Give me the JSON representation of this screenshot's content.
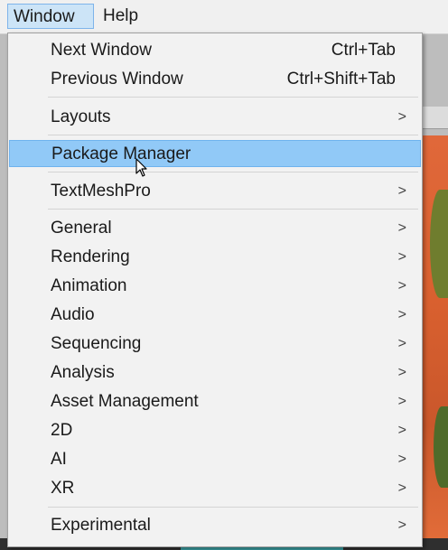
{
  "menubar": {
    "window_label": "Window",
    "help_label": "Help"
  },
  "menu": {
    "next_window": {
      "label": "Next Window",
      "shortcut": "Ctrl+Tab"
    },
    "previous_window": {
      "label": "Previous Window",
      "shortcut": "Ctrl+Shift+Tab"
    },
    "layouts": {
      "label": "Layouts"
    },
    "package_manager": {
      "label": "Package Manager"
    },
    "textmeshpro": {
      "label": "TextMeshPro"
    },
    "general": {
      "label": "General"
    },
    "rendering": {
      "label": "Rendering"
    },
    "animation": {
      "label": "Animation"
    },
    "audio": {
      "label": "Audio"
    },
    "sequencing": {
      "label": "Sequencing"
    },
    "analysis": {
      "label": "Analysis"
    },
    "asset_management": {
      "label": "Asset Management"
    },
    "two_d": {
      "label": "2D"
    },
    "ai": {
      "label": "AI"
    },
    "xr": {
      "label": "XR"
    },
    "experimental": {
      "label": "Experimental"
    },
    "chevron": ">"
  },
  "colors": {
    "highlight": "#91c9f7",
    "menubar_active": "#cce4f7"
  }
}
